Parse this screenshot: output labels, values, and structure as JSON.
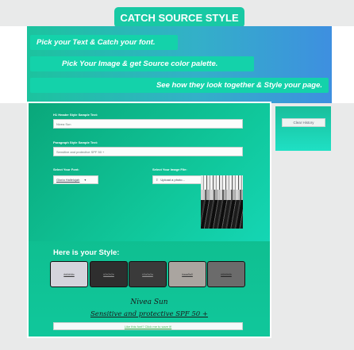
{
  "app": {
    "title": "CATCH SOURCE STYLE",
    "taglines": [
      "Pick your Text & Catch your font.",
      "Pick Your Image & get Source color palette.",
      "See how they look together & Style your page."
    ]
  },
  "form": {
    "h1_label": "H1 Header Style Sample Text:",
    "h1_value": "Nivea Sun",
    "p_label": "Paragraph Style Sample Text:",
    "p_value": "Sensitive and protective SPF 50 +",
    "font_label": "Select Your Font:",
    "font_value": "Gloria Hallelujah",
    "image_label": "Select Your Image File:",
    "upload_label": "Upload a photo..."
  },
  "sidebar": {
    "clear_history": "Clear History"
  },
  "style": {
    "heading": "Here is your Style:",
    "swatches": [
      {
        "label": "#d4d4dc",
        "bg": "#d4d4dc",
        "fg": "#333333"
      },
      {
        "label": "#2e2e2e",
        "bg": "#2e2e2e",
        "fg": "#999999"
      },
      {
        "label": "#3a3a3a",
        "bg": "#3a3a3a",
        "fg": "#999999"
      },
      {
        "label": "#aaa5a0",
        "bg": "#aaa5a0",
        "fg": "#333333"
      },
      {
        "label": "#6b6b6b",
        "bg": "#6b6b6b",
        "fg": "#222222"
      }
    ],
    "sample_h1": "Nivea Sun",
    "sample_p": "Sensitive and protective SPF 50 +",
    "save_link": "Like this font? Click me to save it!"
  },
  "colors": {
    "accent": "#18c9a4",
    "header_gradient_end": "#3e8fe0"
  }
}
